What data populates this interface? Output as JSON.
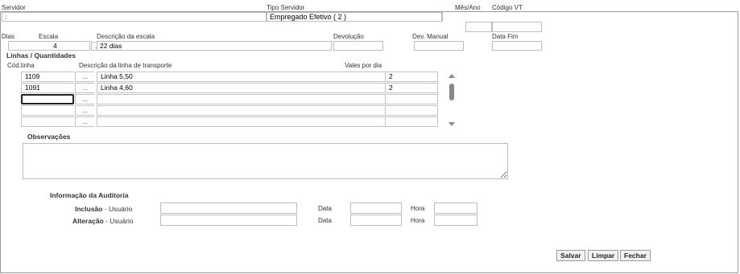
{
  "servidor": {
    "label": "Servidor",
    "value": ":"
  },
  "tipo_servidor": {
    "label": "Tipo Servidor",
    "value": "Empregado Efetivo ( 2 )"
  },
  "mes_ano": {
    "label": "Mês/Ano",
    "value": ""
  },
  "codigo_vt": {
    "label": "Código VT",
    "value": ""
  },
  "dias": {
    "label": "Dias",
    "value": ""
  },
  "escala": {
    "label": "Escala",
    "value": "4",
    "button": "..."
  },
  "descricao_escala": {
    "label": "Descrição da escala",
    "value": "22 dias"
  },
  "devolucao": {
    "label": "Devolução",
    "value": ""
  },
  "dev_manual": {
    "label": "Dev. Manual",
    "value": ""
  },
  "data_fim": {
    "label": "Data Fim",
    "value": ""
  },
  "linhas": {
    "title": "Linhas / Quantidades",
    "headers": {
      "cod": "Cód.linha",
      "descricao": "Descrição da linha de transporte",
      "vales": "Vales por dia"
    },
    "rows": [
      {
        "cod": "1109",
        "btn": "...",
        "descricao": "Linha 5,50",
        "vales": "2"
      },
      {
        "cod": "1091",
        "btn": "...",
        "descricao": "Linha 4,60",
        "vales": "2"
      },
      {
        "cod": "",
        "btn": "...",
        "descricao": "",
        "vales": ""
      },
      {
        "cod": "",
        "btn": "...",
        "descricao": "",
        "vales": ""
      },
      {
        "cod": "",
        "btn": "...",
        "descricao": "",
        "vales": ""
      }
    ]
  },
  "observacoes": {
    "label": "Observações",
    "value": ""
  },
  "auditoria": {
    "title": "Informação da Auditoria",
    "inclusao": {
      "bold": "Inclusão",
      "rest": " - Usuário",
      "data_label": "Data",
      "hora_label": "Hora",
      "usuario": "",
      "data": "",
      "hora": ""
    },
    "alteracao": {
      "bold": "Alteração",
      "rest": " - Usuário",
      "data_label": "Data",
      "hora_label": "Hora",
      "usuario": "",
      "data": "",
      "hora": ""
    }
  },
  "actions": {
    "salvar": "Salvar",
    "limpar": "Limpar",
    "fechar": "Fechar"
  }
}
